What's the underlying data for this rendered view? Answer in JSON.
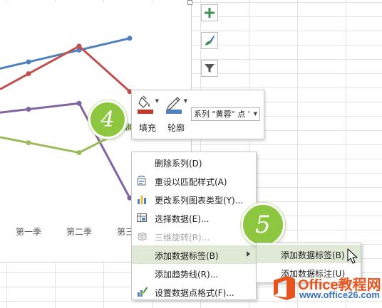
{
  "chart_data": {
    "type": "line",
    "categories": [
      "第一季",
      "第二季",
      "第三季"
    ],
    "series": [
      {
        "values": [
          78,
          90,
          102
        ],
        "color": "#4f81bd"
      },
      {
        "values": [
          66,
          94,
          48
        ],
        "color": "#c0504d"
      },
      {
        "values": [
          30,
          36,
          -60
        ],
        "color": "#8064a2"
      },
      {
        "values": [
          -4,
          -14,
          12
        ],
        "color": "#9bbb59"
      }
    ],
    "ylim": [
      -80,
      130
    ]
  },
  "side_buttons": {
    "elements_icon": "plus-icon",
    "styles_icon": "paintbrush-icon",
    "filter_icon": "filter-icon"
  },
  "mini_toolbar": {
    "fill_label": "填充",
    "outline_label": "轮廓",
    "series_select_value": "系列 \"黄蓉\" 点 '",
    "fill_color": "#c0392b",
    "outline_color": "#4f81bd"
  },
  "steps": {
    "step_a": "4",
    "step_b": "5"
  },
  "context_menu": {
    "items": [
      {
        "label": "删除系列(D)",
        "icon": ""
      },
      {
        "label": "重设以匹配样式(A)",
        "icon": "reset-style-icon"
      },
      {
        "label": "更改系列图表类型(Y)...",
        "icon": "bar-chart-icon"
      },
      {
        "label": "选择数据(E)...",
        "icon": "select-data-icon"
      },
      {
        "label": "三维旋转(R)...",
        "icon": "3d-rotation-icon"
      },
      {
        "label": "添加数据标签(B)",
        "icon": ""
      },
      {
        "label": "添加趋势线(R)...",
        "icon": ""
      },
      {
        "label": "设置数据点格式(F)...",
        "icon": "format-data-point-icon"
      }
    ]
  },
  "submenu": {
    "items": [
      {
        "label": "添加数据标签(B)"
      },
      {
        "label": "添加数据标注(U)"
      }
    ]
  },
  "watermark": {
    "name": "Office教程网",
    "url": "www.office26.com"
  },
  "colors": {
    "accent_green": "#8dc63f",
    "menu_highlight": "#dfe9d6"
  }
}
